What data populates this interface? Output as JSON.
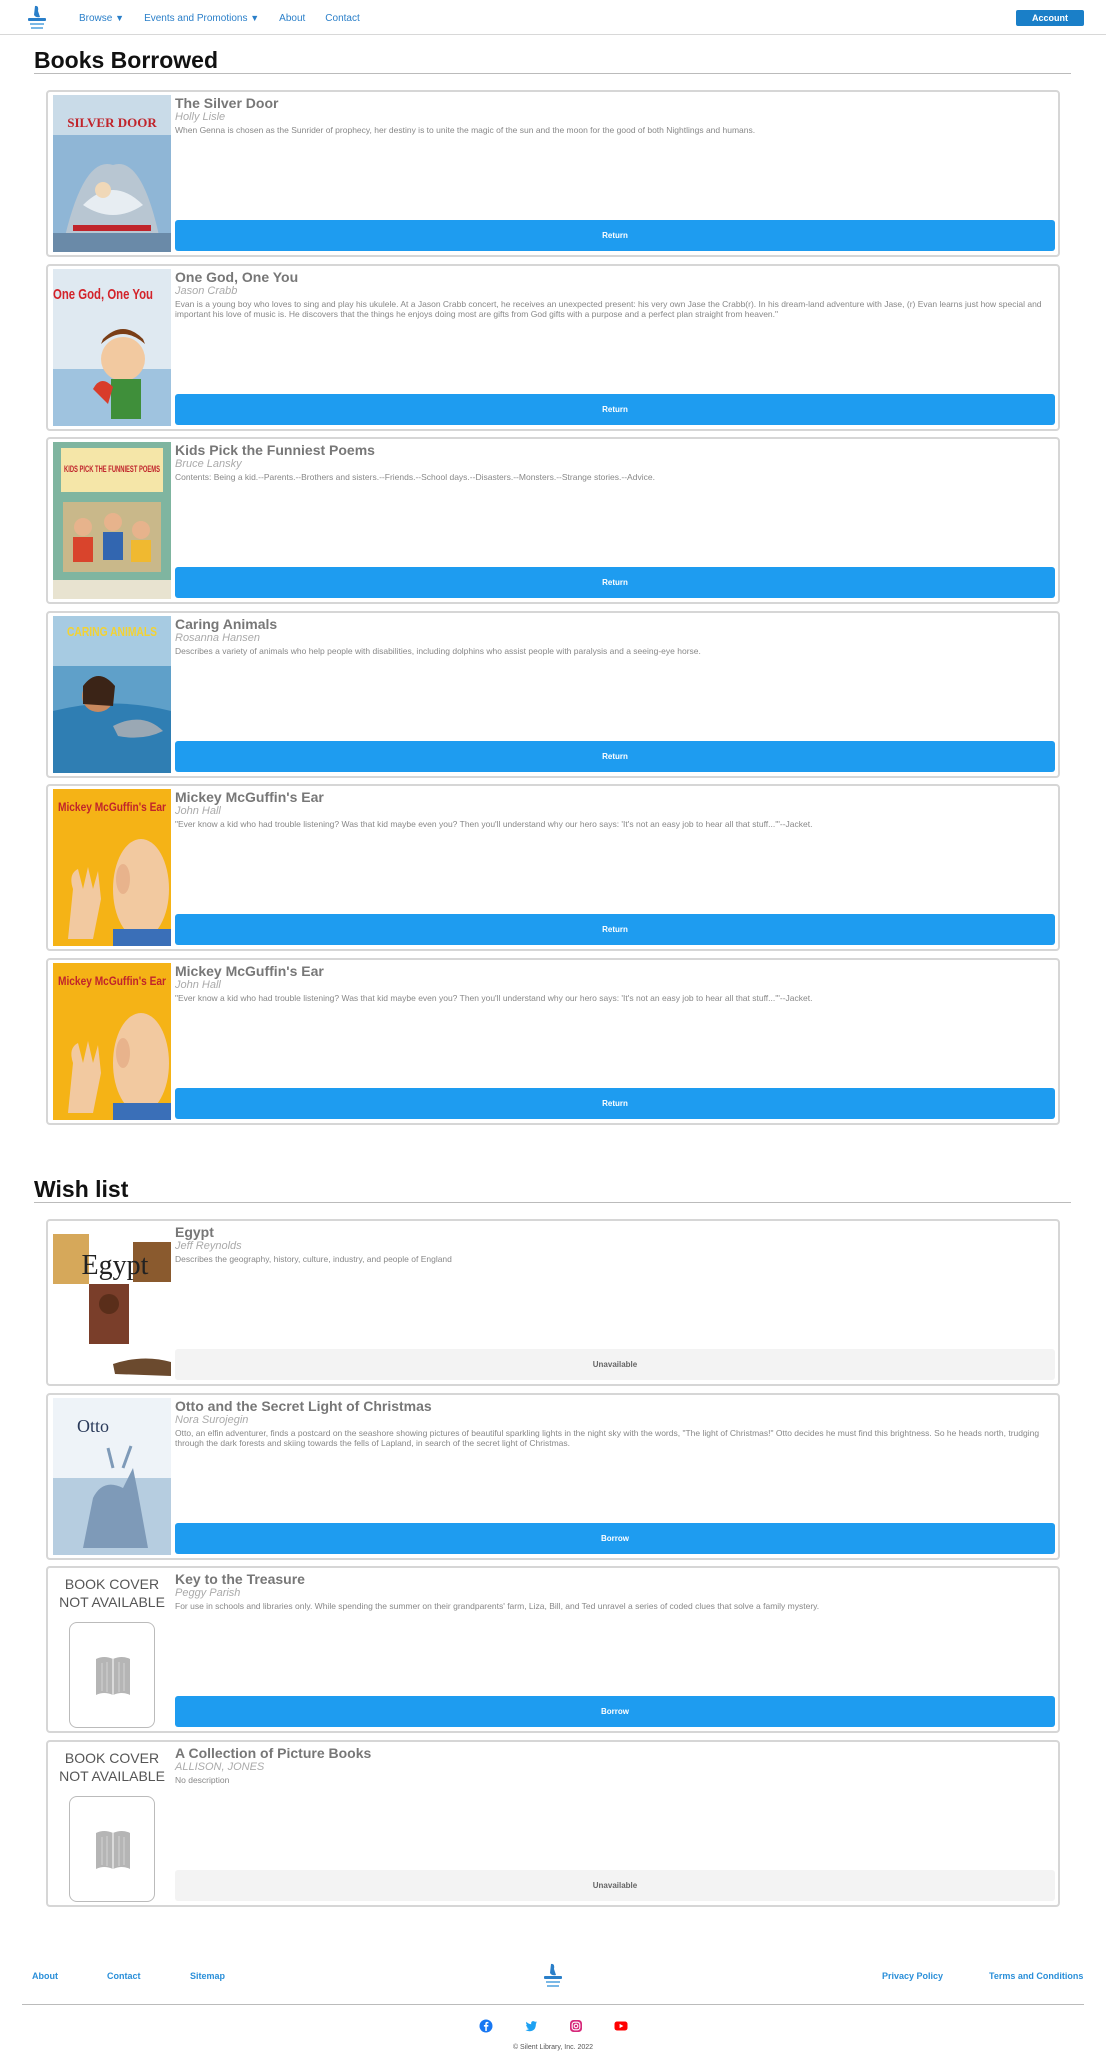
{
  "nav": {
    "browse": "Browse",
    "events": "Events and Promotions",
    "about": "About",
    "contact": "Contact",
    "caret": "▼",
    "account": "Account"
  },
  "borrowed": {
    "title": "Books Borrowed",
    "books": [
      {
        "title": "The Silver Door",
        "author": "Holly Lisle",
        "desc": "When Genna is chosen as the Sunrider of prophecy, her destiny is to unite the magic of the sun and the moon for the good of both Nightlings and humans.",
        "action": "Return",
        "cover_text": "SILVER DOOR"
      },
      {
        "title": "One God, One You",
        "author": "Jason Crabb",
        "desc": "Evan is a young boy who loves to sing and play his ukulele. At a Jason Crabb concert, he receives an unexpected present: his very own Jase the Crabb(r). In his dream-land adventure with Jase, (r) Evan learns just how special and important his love of music is. He discovers that the things he enjoys doing most are gifts from God gifts with a purpose and a perfect plan straight from heaven.\"",
        "action": "Return",
        "cover_text": "One God, One You"
      },
      {
        "title": "Kids Pick the Funniest Poems",
        "author": "Bruce Lansky",
        "desc": "Contents: Being a kid.--Parents.--Brothers and sisters.--Friends.--School days.--Disasters.--Monsters.--Strange stories.--Advice.",
        "action": "Return",
        "cover_text": "KIDS PICK THE FUNNIEST POEMS"
      },
      {
        "title": "Caring Animals",
        "author": "Rosanna Hansen",
        "desc": "Describes a variety of animals who help people with disabilities, including dolphins who assist people with paralysis and a seeing-eye horse.",
        "action": "Return",
        "cover_text": "CARING ANIMALS"
      },
      {
        "title": "Mickey McGuffin's Ear",
        "author": "John Hall",
        "desc": "\"Ever know a kid who had trouble listening? Was that kid maybe even you? Then you'll understand why our hero says: 'It's not an easy job to hear all that stuff...'\"--Jacket.",
        "action": "Return",
        "cover_text": "Mickey McGuffin's Ear"
      },
      {
        "title": "Mickey McGuffin's Ear",
        "author": "John Hall",
        "desc": "\"Ever know a kid who had trouble listening? Was that kid maybe even you? Then you'll understand why our hero says: 'It's not an easy job to hear all that stuff...'\"--Jacket.",
        "action": "Return",
        "cover_text": "Mickey McGuffin's Ear"
      }
    ]
  },
  "wishlist": {
    "title": "Wish list",
    "books": [
      {
        "title": "Egypt",
        "author": "Jeff Reynolds",
        "desc": "Describes the geography, history, culture, industry, and people of England",
        "action": "Unavailable",
        "cover_text": "Egypt"
      },
      {
        "title": "Otto and the Secret Light of Christmas",
        "author": "Nora Surojegin",
        "desc": "Otto, an elfin adventurer, finds a postcard on the seashore showing pictures of beautiful sparkling lights in the night sky with the words, \"The light of Christmas!\" Otto decides he must find this brightness. So he heads north, trudging through the dark forests and skiing towards the fells of Lapland, in search of the secret light of Christmas.",
        "action": "Borrow",
        "cover_text": "Otto"
      },
      {
        "title": "Key to the Treasure",
        "author": "Peggy Parish",
        "desc": "For use in schools and libraries only. While spending the summer on their grandparents' farm, Liza, Bill, and Ted unravel a series of coded clues that solve a family mystery.",
        "action": "Borrow",
        "cover_text": "BOOK COVER NOT AVAILABLE"
      },
      {
        "title": "A Collection of Picture Books",
        "author": "ALLISON, JONES",
        "desc": "No description",
        "action": "Unavailable",
        "cover_text": "BOOK COVER NOT AVAILABLE"
      }
    ]
  },
  "footer": {
    "about": "About",
    "contact": "Contact",
    "sitemap": "Sitemap",
    "privacy": "Privacy Policy",
    "terms": "Terms and Conditions",
    "copyright": "© Silent Library, Inc. 2022"
  },
  "colors": {
    "accent": "#1e9cf0",
    "account": "#1a7fc8",
    "link": "#2a7fc9"
  },
  "icons": [
    "logo-icon",
    "facebook-icon",
    "twitter-icon",
    "instagram-icon",
    "youtube-icon",
    "book-icon"
  ]
}
